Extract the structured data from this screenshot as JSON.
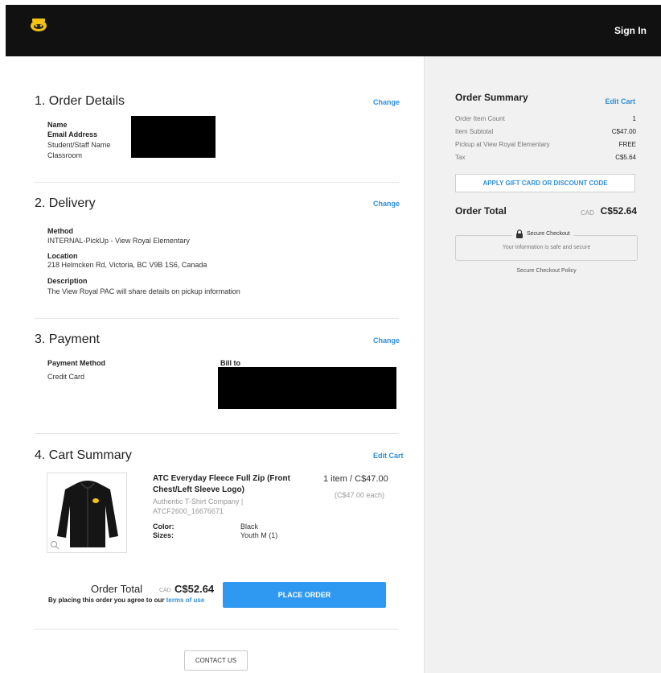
{
  "header": {
    "sign_in": "Sign In"
  },
  "order_details": {
    "title": "1. Order Details",
    "change": "Change",
    "labels": [
      "Name",
      "Email Address",
      "Student/Staff Name",
      "Classroom"
    ]
  },
  "delivery": {
    "title": "2. Delivery",
    "change": "Change",
    "method_label": "Method",
    "method_value": "INTERNAL-PickUp - View Royal Elementary",
    "location_label": "Location",
    "location_value": "218 Helmcken Rd, Victoria, BC V9B 1S6, Canada",
    "description_label": "Description",
    "description_value": "The View Royal PAC will share details on pickup information"
  },
  "payment": {
    "title": "3. Payment",
    "change": "Change",
    "method_label": "Payment Method",
    "method_value": "Credit Card",
    "bill_to_label": "Bill to"
  },
  "cart": {
    "title": "4. Cart Summary",
    "edit": "Edit Cart",
    "product_name_line1": "ATC Everyday Fleece Full Zip (Front",
    "product_name_line2": "Chest/Left Sleeve Logo)",
    "vendor": "Authentic T-Shirt Company |",
    "sku": "ATCF2600_16676671",
    "color_label": "Color:",
    "color_value": "Black",
    "sizes_label": "Sizes:",
    "sizes_value": "Youth M (1)",
    "qty_price": "1 item / C$47.00",
    "each_price": "(C$47.00 each)"
  },
  "footer_order": {
    "total_label": "Order Total",
    "currency": "CAD",
    "total_value": "C$52.64",
    "agree_text": "By placing this order you agree to our ",
    "terms_link": "terms of use",
    "place_order": "PLACE ORDER",
    "contact_us": "CONTACT US"
  },
  "summary": {
    "title": "Order Summary",
    "edit_cart": "Edit Cart",
    "rows": [
      {
        "label": "Order Item Count",
        "value": "1"
      },
      {
        "label": "Item Subtotal",
        "value": "C$47.00"
      },
      {
        "label": "Pickup at View Royal Elementary",
        "value": "FREE"
      },
      {
        "label": "Tax",
        "value": "C$5.64"
      }
    ],
    "gift_button": "APPLY GIFT CARD OR DISCOUNT CODE",
    "total_label": "Order Total",
    "total_currency": "CAD",
    "total_value": "C$52.64",
    "secure_title": "Secure Checkout",
    "secure_sub": "Your information is safe and secure",
    "policy_link": "Secure Checkout Policy"
  },
  "colors": {
    "accent": "#2f8fdc",
    "button": "#2f98f0",
    "header_bg": "#111111",
    "sidebar_bg": "#f1f1f1"
  }
}
